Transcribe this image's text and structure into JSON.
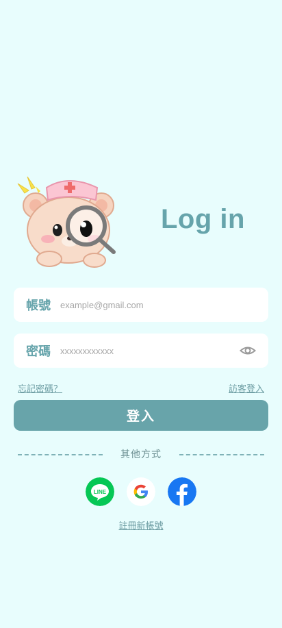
{
  "header": {
    "title": "Log in"
  },
  "account": {
    "label": "帳號",
    "placeholder": "example@gmail.com",
    "value": ""
  },
  "password": {
    "label": "密碼",
    "placeholder": "xxxxxxxxxxxx",
    "value": "",
    "toggle_icon": "eye-icon"
  },
  "links": {
    "forgot": "忘記密碼？",
    "guest": "訪客登入",
    "register": "註冊新帳號"
  },
  "login_button": {
    "label": "登入"
  },
  "divider": {
    "text": "其他方式"
  },
  "social": [
    {
      "name": "LINE",
      "icon": "line-icon",
      "color": "#06c755",
      "text": "LINE"
    },
    {
      "name": "Google",
      "icon": "google-icon"
    },
    {
      "name": "Facebook",
      "icon": "facebook-icon",
      "color": "#1877f2"
    }
  ],
  "colors": {
    "background": "#e8fdfd",
    "accent": "#68a4aa",
    "field": "#ffffff"
  }
}
